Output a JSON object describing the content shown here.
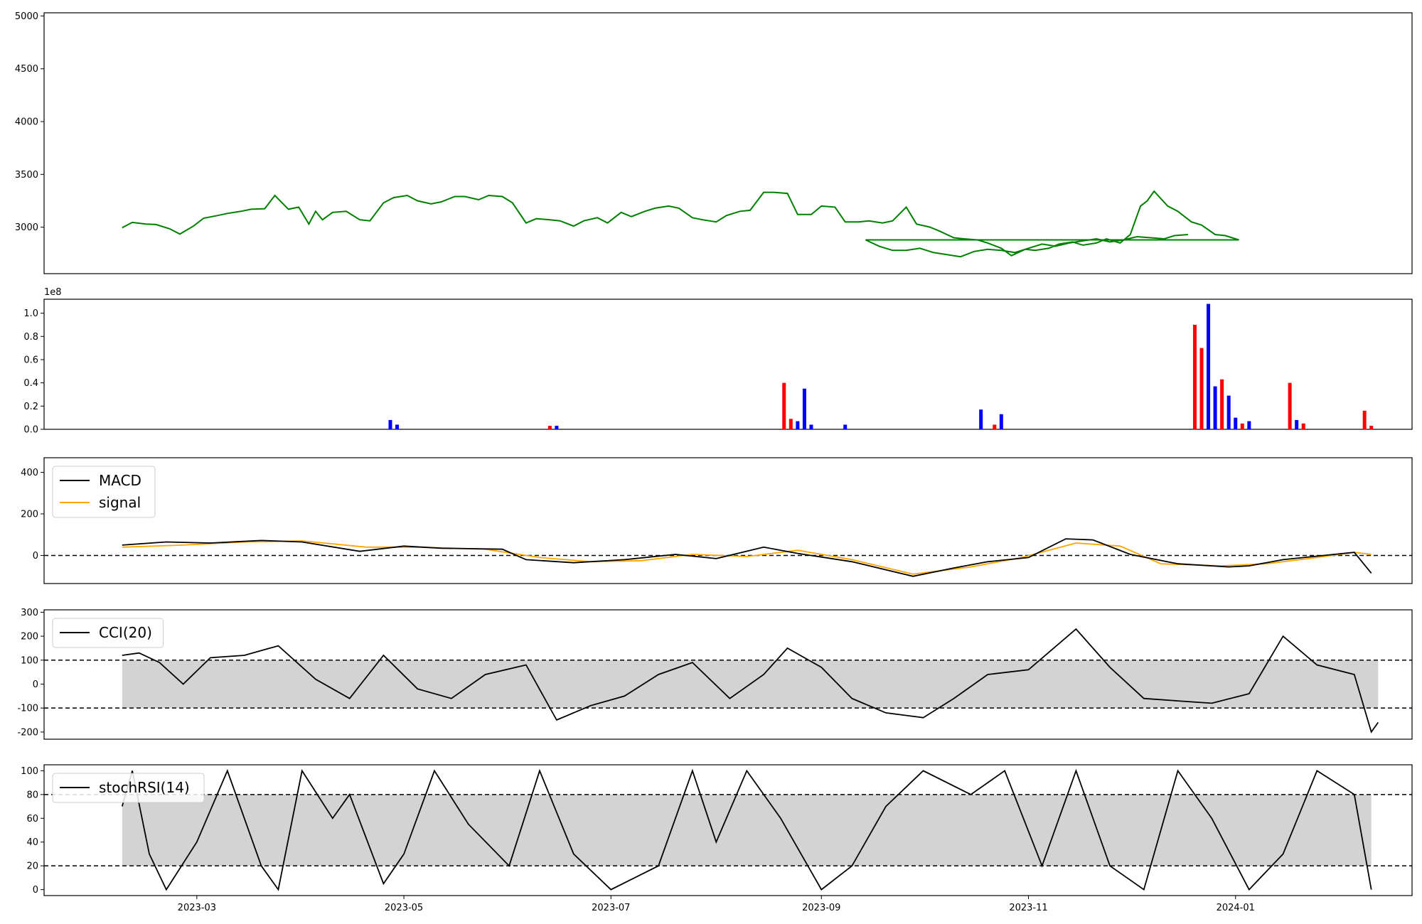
{
  "colors": {
    "price": "#008000",
    "up": "#ff0000",
    "down": "#0000ff",
    "macd": "#000000",
    "signal": "#ffa500",
    "band": "#d3d3d3",
    "reference": "#000000"
  },
  "x_axis": {
    "start": "2023-01-15",
    "end": "2024-02-22",
    "ticks": [
      "2023-03",
      "2023-05",
      "2023-07",
      "2023-09",
      "2023-11",
      "2024-01"
    ]
  },
  "chart_data": [
    {
      "type": "line",
      "name": "price",
      "ylim": [
        2560,
        5030
      ],
      "yticks": [
        "3000",
        "3500",
        "4000",
        "4500",
        "5000"
      ],
      "points": [
        [
          "2023-02-07",
          2995
        ],
        [
          "2023-02-10",
          3045
        ],
        [
          "2023-02-14",
          3030
        ],
        [
          "2023-02-17",
          3025
        ],
        [
          "2023-02-21",
          2985
        ],
        [
          "2023-02-24",
          2935
        ],
        [
          "2023-02-28",
          3010
        ],
        [
          "2023-03-03",
          3085
        ],
        [
          "2023-03-07",
          3110
        ],
        [
          "2023-03-10",
          3130
        ],
        [
          "2023-03-14",
          3150
        ],
        [
          "2023-03-17",
          3170
        ],
        [
          "2023-03-21",
          3175
        ],
        [
          "2023-03-24",
          3300
        ],
        [
          "2023-03-28",
          3170
        ],
        [
          "2023-03-31",
          3190
        ],
        [
          "2023-04-03",
          3030
        ],
        [
          "2023-04-05",
          3150
        ],
        [
          "2023-04-07",
          3070
        ],
        [
          "2023-04-10",
          3140
        ],
        [
          "2023-04-14",
          3150
        ],
        [
          "2023-04-18",
          3070
        ],
        [
          "2023-04-21",
          3060
        ],
        [
          "2023-04-25",
          3230
        ],
        [
          "2023-04-28",
          3280
        ],
        [
          "2023-05-02",
          3300
        ],
        [
          "2023-05-05",
          3250
        ],
        [
          "2023-05-09",
          3220
        ],
        [
          "2023-05-12",
          3240
        ],
        [
          "2023-05-16",
          3290
        ],
        [
          "2023-05-19",
          3290
        ],
        [
          "2023-05-23",
          3260
        ],
        [
          "2023-05-26",
          3300
        ],
        [
          "2023-05-30",
          3290
        ],
        [
          "2023-06-02",
          3230
        ],
        [
          "2023-06-06",
          3040
        ],
        [
          "2023-06-09",
          3080
        ],
        [
          "2023-06-13",
          3070
        ],
        [
          "2023-06-16",
          3060
        ],
        [
          "2023-06-20",
          3010
        ],
        [
          "2023-06-23",
          3060
        ],
        [
          "2023-06-27",
          3090
        ],
        [
          "2023-06-30",
          3040
        ],
        [
          "2023-07-04",
          3140
        ],
        [
          "2023-07-07",
          3100
        ],
        [
          "2023-07-11",
          3150
        ],
        [
          "2023-07-14",
          3180
        ],
        [
          "2023-07-18",
          3200
        ],
        [
          "2023-07-21",
          3180
        ],
        [
          "2023-07-25",
          3090
        ],
        [
          "2023-07-28",
          3070
        ],
        [
          "2023-08-01",
          3050
        ],
        [
          "2023-08-04",
          3110
        ],
        [
          "2023-08-08",
          3150
        ],
        [
          "2023-08-11",
          3160
        ],
        [
          "2023-08-15",
          3330
        ],
        [
          "2023-08-18",
          3330
        ],
        [
          "2023-08-22",
          3320
        ],
        [
          "2023-08-25",
          3120
        ],
        [
          "2023-08-29",
          3120
        ],
        [
          "2023-09-01",
          3200
        ],
        [
          "2023-09-05",
          3190
        ],
        [
          "2023-09-08",
          3050
        ],
        [
          "2023-09-12",
          3050
        ],
        [
          "2023-09-15",
          3060
        ],
        [
          "2023-09-19",
          3040
        ],
        [
          "2023-09-22",
          3060
        ],
        [
          "2023-09-26",
          3190
        ],
        [
          "2023-09-29",
          3030
        ],
        [
          "2023-10-03",
          3000
        ],
        [
          "2023-10-06",
          2960
        ],
        [
          "2023-10-10",
          2900
        ],
        [
          "2023-10-13",
          2890
        ],
        [
          "2023-10-17",
          2880
        ],
        [
          "2023-10-20",
          2850
        ],
        [
          "2023-10-24",
          2800
        ],
        [
          "2023-10-27",
          2730
        ],
        [
          "2023-10-31",
          2790
        ],
        [
          "2023-11-03",
          2780
        ],
        [
          "2023-11-07",
          2800
        ],
        [
          "2023-11-10",
          2840
        ],
        [
          "2023-11-14",
          2860
        ],
        [
          "2023-11-17",
          2830
        ],
        [
          "2023-11-21",
          2850
        ],
        [
          "2023-11-24",
          2890
        ],
        [
          "2023-11-28",
          2850
        ],
        [
          "2023-12-01",
          2930
        ],
        [
          "2023-12-04",
          3200
        ],
        [
          "2023-12-06",
          3250
        ],
        [
          "2023-12-08",
          3340
        ],
        [
          "2023-12-12",
          3200
        ],
        [
          "2023-12-15",
          3150
        ],
        [
          "2023-12-19",
          3050
        ],
        [
          "2023-12-22",
          3020
        ],
        [
          "2023-12-26",
          2930
        ],
        [
          "2023-12-29",
          2920
        ],
        [
          "2024-01-02",
          2880
        ],
        [
          "2023-09-10",
          2920
        ],
        [
          "2023-09-14",
          2880
        ],
        [
          "2023-09-18",
          2820
        ],
        [
          "2023-09-22",
          2780
        ],
        [
          "2023-09-26",
          2780
        ],
        [
          "2023-09-30",
          2800
        ],
        [
          "2023-10-04",
          2760
        ],
        [
          "2023-10-08",
          2740
        ],
        [
          "2023-10-12",
          2720
        ],
        [
          "2023-10-16",
          2770
        ],
        [
          "2023-10-20",
          2790
        ],
        [
          "2023-10-24",
          2780
        ],
        [
          "2023-10-28",
          2760
        ],
        [
          "2023-11-01",
          2800
        ],
        [
          "2023-11-05",
          2840
        ],
        [
          "2023-11-09",
          2820
        ],
        [
          "2023-11-13",
          2850
        ],
        [
          "2023-11-17",
          2870
        ],
        [
          "2023-11-21",
          2890
        ],
        [
          "2023-11-25",
          2860
        ],
        [
          "2023-11-29",
          2880
        ],
        [
          "2023-12-03",
          2910
        ],
        [
          "2023-12-07",
          2900
        ],
        [
          "2023-12-11",
          2890
        ],
        [
          "2023-12-14",
          2920
        ],
        [
          "2023-12-18",
          2930
        ]
      ]
    },
    {
      "type": "bar",
      "name": "volume",
      "ylim": [
        0,
        1.12
      ],
      "scale_label": "1e8",
      "yticks": [
        "0.0",
        "0.2",
        "0.4",
        "0.6",
        "0.8",
        "1.0"
      ],
      "spikes": [
        [
          "2023-04-27",
          0.08,
          "down"
        ],
        [
          "2023-04-29",
          0.04,
          "down"
        ],
        [
          "2023-06-13",
          0.03,
          "up"
        ],
        [
          "2023-06-15",
          0.03,
          "down"
        ],
        [
          "2023-08-21",
          0.4,
          "up"
        ],
        [
          "2023-08-23",
          0.09,
          "up"
        ],
        [
          "2023-08-25",
          0.07,
          "down"
        ],
        [
          "2023-08-27",
          0.35,
          "down"
        ],
        [
          "2023-08-29",
          0.04,
          "down"
        ],
        [
          "2023-09-08",
          0.04,
          "down"
        ],
        [
          "2023-10-18",
          0.17,
          "down"
        ],
        [
          "2023-10-22",
          0.04,
          "up"
        ],
        [
          "2023-10-24",
          0.13,
          "down"
        ],
        [
          "2023-12-20",
          0.9,
          "up"
        ],
        [
          "2023-12-22",
          0.7,
          "up"
        ],
        [
          "2023-12-24",
          1.08,
          "down"
        ],
        [
          "2023-12-26",
          0.37,
          "down"
        ],
        [
          "2023-12-28",
          0.43,
          "up"
        ],
        [
          "2023-12-30",
          0.29,
          "down"
        ],
        [
          "2024-01-01",
          0.1,
          "down"
        ],
        [
          "2024-01-03",
          0.05,
          "up"
        ],
        [
          "2024-01-05",
          0.07,
          "down"
        ],
        [
          "2024-01-17",
          0.4,
          "up"
        ],
        [
          "2024-01-19",
          0.08,
          "down"
        ],
        [
          "2024-01-21",
          0.05,
          "up"
        ],
        [
          "2024-02-08",
          0.16,
          "up"
        ],
        [
          "2024-02-10",
          0.03,
          "up"
        ]
      ]
    },
    {
      "type": "line",
      "name": "macd",
      "ylim": [
        -135,
        470
      ],
      "yticks": [
        "0",
        "200",
        "400"
      ],
      "legend": [
        "MACD",
        "signal"
      ],
      "macd": [
        [
          "2023-02-07",
          50
        ],
        [
          "2023-02-20",
          65
        ],
        [
          "2023-03-05",
          60
        ],
        [
          "2023-03-20",
          72
        ],
        [
          "2023-04-01",
          65
        ],
        [
          "2023-04-18",
          20
        ],
        [
          "2023-05-01",
          45
        ],
        [
          "2023-05-12",
          35
        ],
        [
          "2023-05-30",
          30
        ],
        [
          "2023-06-06",
          -20
        ],
        [
          "2023-06-20",
          -35
        ],
        [
          "2023-07-05",
          -20
        ],
        [
          "2023-07-20",
          5
        ],
        [
          "2023-08-01",
          -15
        ],
        [
          "2023-08-15",
          40
        ],
        [
          "2023-08-25",
          10
        ],
        [
          "2023-09-10",
          -30
        ],
        [
          "2023-09-28",
          -100
        ],
        [
          "2023-10-10",
          -60
        ],
        [
          "2023-10-20",
          -30
        ],
        [
          "2023-11-01",
          -10
        ],
        [
          "2023-11-12",
          80
        ],
        [
          "2023-11-20",
          75
        ],
        [
          "2023-12-01",
          5
        ],
        [
          "2023-12-15",
          -40
        ],
        [
          "2023-12-30",
          -55
        ],
        [
          "2024-01-05",
          -50
        ],
        [
          "2024-01-15",
          -20
        ],
        [
          "2024-01-30",
          5
        ],
        [
          "2024-02-05",
          15
        ],
        [
          "2024-02-10",
          -85
        ]
      ],
      "signal": [
        [
          "2023-02-07",
          40
        ],
        [
          "2023-02-25",
          50
        ],
        [
          "2023-03-15",
          65
        ],
        [
          "2023-04-01",
          70
        ],
        [
          "2023-04-20",
          40
        ],
        [
          "2023-05-05",
          40
        ],
        [
          "2023-05-25",
          30
        ],
        [
          "2023-06-10",
          -10
        ],
        [
          "2023-06-25",
          -30
        ],
        [
          "2023-07-10",
          -25
        ],
        [
          "2023-07-25",
          5
        ],
        [
          "2023-08-10",
          -5
        ],
        [
          "2023-08-25",
          25
        ],
        [
          "2023-09-10",
          -20
        ],
        [
          "2023-09-28",
          -90
        ],
        [
          "2023-10-15",
          -55
        ],
        [
          "2023-10-30",
          -10
        ],
        [
          "2023-11-15",
          60
        ],
        [
          "2023-11-28",
          45
        ],
        [
          "2023-12-10",
          -40
        ],
        [
          "2023-12-28",
          -50
        ],
        [
          "2024-01-10",
          -40
        ],
        [
          "2024-01-25",
          -10
        ],
        [
          "2024-02-05",
          15
        ],
        [
          "2024-02-10",
          5
        ]
      ]
    },
    {
      "type": "line",
      "name": "cci",
      "ylim": [
        -230,
        310
      ],
      "yticks": [
        "-200",
        "-100",
        "0",
        "100",
        "200",
        "300"
      ],
      "legend": [
        "CCI(20)"
      ],
      "bands": [
        -100,
        100
      ],
      "points": [
        [
          "2023-02-07",
          120
        ],
        [
          "2023-02-12",
          130
        ],
        [
          "2023-02-18",
          90
        ],
        [
          "2023-02-25",
          0
        ],
        [
          "2023-03-05",
          110
        ],
        [
          "2023-03-15",
          120
        ],
        [
          "2023-03-25",
          160
        ],
        [
          "2023-04-05",
          20
        ],
        [
          "2023-04-15",
          -60
        ],
        [
          "2023-04-25",
          120
        ],
        [
          "2023-05-05",
          -20
        ],
        [
          "2023-05-15",
          -60
        ],
        [
          "2023-05-25",
          40
        ],
        [
          "2023-06-06",
          80
        ],
        [
          "2023-06-15",
          -150
        ],
        [
          "2023-06-25",
          -90
        ],
        [
          "2023-07-05",
          -50
        ],
        [
          "2023-07-15",
          40
        ],
        [
          "2023-07-25",
          90
        ],
        [
          "2023-08-05",
          -60
        ],
        [
          "2023-08-15",
          40
        ],
        [
          "2023-08-22",
          150
        ],
        [
          "2023-09-01",
          70
        ],
        [
          "2023-09-10",
          -60
        ],
        [
          "2023-09-20",
          -120
        ],
        [
          "2023-10-01",
          -140
        ],
        [
          "2023-10-10",
          -60
        ],
        [
          "2023-10-20",
          40
        ],
        [
          "2023-11-01",
          60
        ],
        [
          "2023-11-15",
          230
        ],
        [
          "2023-11-25",
          70
        ],
        [
          "2023-12-05",
          -60
        ],
        [
          "2023-12-15",
          -70
        ],
        [
          "2023-12-25",
          -80
        ],
        [
          "2024-01-05",
          -40
        ],
        [
          "2024-01-15",
          200
        ],
        [
          "2024-01-25",
          80
        ],
        [
          "2024-02-05",
          40
        ],
        [
          "2024-02-10",
          -200
        ],
        [
          "2024-02-12",
          -160
        ]
      ]
    },
    {
      "type": "line",
      "name": "stochrsi",
      "ylim": [
        -5,
        105
      ],
      "yticks": [
        "0",
        "20",
        "40",
        "60",
        "80",
        "100"
      ],
      "legend": [
        "stochRSI(14)"
      ],
      "bands": [
        20,
        80
      ],
      "points": [
        [
          "2023-02-07",
          70
        ],
        [
          "2023-02-10",
          100
        ],
        [
          "2023-02-15",
          30
        ],
        [
          "2023-02-20",
          0
        ],
        [
          "2023-03-01",
          40
        ],
        [
          "2023-03-10",
          100
        ],
        [
          "2023-03-20",
          20
        ],
        [
          "2023-03-25",
          0
        ],
        [
          "2023-04-01",
          100
        ],
        [
          "2023-04-10",
          60
        ],
        [
          "2023-04-15",
          80
        ],
        [
          "2023-04-25",
          5
        ],
        [
          "2023-05-01",
          30
        ],
        [
          "2023-05-10",
          100
        ],
        [
          "2023-05-20",
          55
        ],
        [
          "2023-06-01",
          20
        ],
        [
          "2023-06-10",
          100
        ],
        [
          "2023-06-20",
          30
        ],
        [
          "2023-07-01",
          0
        ],
        [
          "2023-07-15",
          20
        ],
        [
          "2023-07-25",
          100
        ],
        [
          "2023-08-01",
          40
        ],
        [
          "2023-08-10",
          100
        ],
        [
          "2023-08-20",
          60
        ],
        [
          "2023-09-01",
          0
        ],
        [
          "2023-09-10",
          20
        ],
        [
          "2023-09-20",
          70
        ],
        [
          "2023-10-01",
          100
        ],
        [
          "2023-10-15",
          80
        ],
        [
          "2023-10-25",
          100
        ],
        [
          "2023-11-05",
          20
        ],
        [
          "2023-11-15",
          100
        ],
        [
          "2023-11-25",
          20
        ],
        [
          "2023-12-05",
          0
        ],
        [
          "2023-12-15",
          100
        ],
        [
          "2023-12-25",
          60
        ],
        [
          "2024-01-05",
          0
        ],
        [
          "2024-01-15",
          30
        ],
        [
          "2024-01-25",
          100
        ],
        [
          "2024-02-05",
          80
        ],
        [
          "2024-02-10",
          0
        ]
      ]
    }
  ]
}
